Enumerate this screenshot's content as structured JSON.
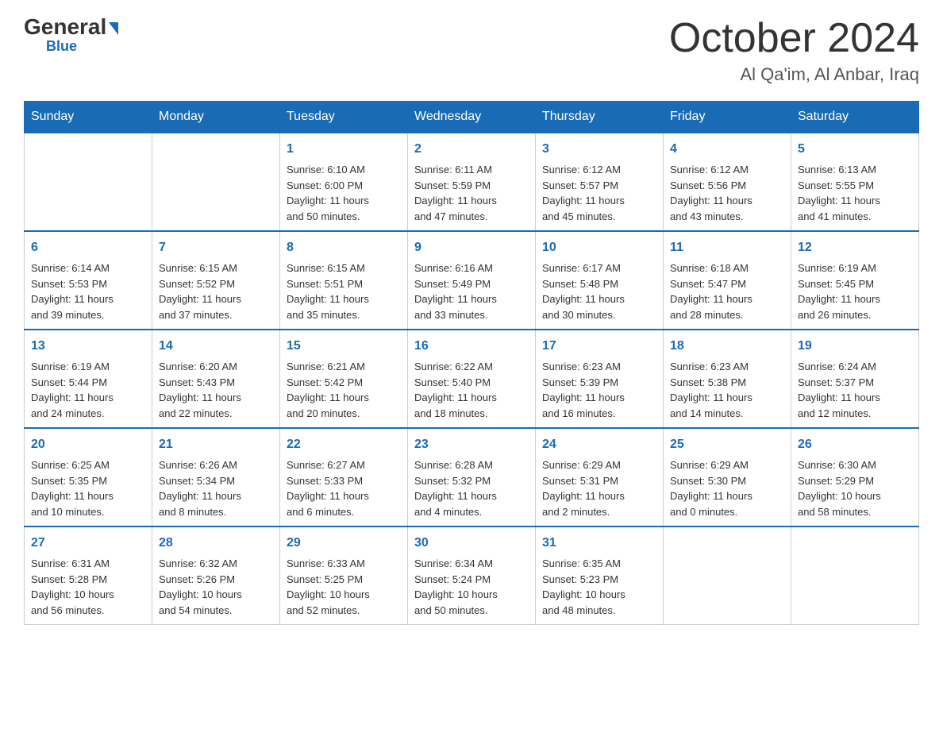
{
  "header": {
    "logo_general": "General",
    "logo_blue": "Blue",
    "month_title": "October 2024",
    "location": "Al Qa'im, Al Anbar, Iraq"
  },
  "days_of_week": [
    "Sunday",
    "Monday",
    "Tuesday",
    "Wednesday",
    "Thursday",
    "Friday",
    "Saturday"
  ],
  "weeks": [
    [
      {
        "day": "",
        "info": ""
      },
      {
        "day": "",
        "info": ""
      },
      {
        "day": "1",
        "info": "Sunrise: 6:10 AM\nSunset: 6:00 PM\nDaylight: 11 hours\nand 50 minutes."
      },
      {
        "day": "2",
        "info": "Sunrise: 6:11 AM\nSunset: 5:59 PM\nDaylight: 11 hours\nand 47 minutes."
      },
      {
        "day": "3",
        "info": "Sunrise: 6:12 AM\nSunset: 5:57 PM\nDaylight: 11 hours\nand 45 minutes."
      },
      {
        "day": "4",
        "info": "Sunrise: 6:12 AM\nSunset: 5:56 PM\nDaylight: 11 hours\nand 43 minutes."
      },
      {
        "day": "5",
        "info": "Sunrise: 6:13 AM\nSunset: 5:55 PM\nDaylight: 11 hours\nand 41 minutes."
      }
    ],
    [
      {
        "day": "6",
        "info": "Sunrise: 6:14 AM\nSunset: 5:53 PM\nDaylight: 11 hours\nand 39 minutes."
      },
      {
        "day": "7",
        "info": "Sunrise: 6:15 AM\nSunset: 5:52 PM\nDaylight: 11 hours\nand 37 minutes."
      },
      {
        "day": "8",
        "info": "Sunrise: 6:15 AM\nSunset: 5:51 PM\nDaylight: 11 hours\nand 35 minutes."
      },
      {
        "day": "9",
        "info": "Sunrise: 6:16 AM\nSunset: 5:49 PM\nDaylight: 11 hours\nand 33 minutes."
      },
      {
        "day": "10",
        "info": "Sunrise: 6:17 AM\nSunset: 5:48 PM\nDaylight: 11 hours\nand 30 minutes."
      },
      {
        "day": "11",
        "info": "Sunrise: 6:18 AM\nSunset: 5:47 PM\nDaylight: 11 hours\nand 28 minutes."
      },
      {
        "day": "12",
        "info": "Sunrise: 6:19 AM\nSunset: 5:45 PM\nDaylight: 11 hours\nand 26 minutes."
      }
    ],
    [
      {
        "day": "13",
        "info": "Sunrise: 6:19 AM\nSunset: 5:44 PM\nDaylight: 11 hours\nand 24 minutes."
      },
      {
        "day": "14",
        "info": "Sunrise: 6:20 AM\nSunset: 5:43 PM\nDaylight: 11 hours\nand 22 minutes."
      },
      {
        "day": "15",
        "info": "Sunrise: 6:21 AM\nSunset: 5:42 PM\nDaylight: 11 hours\nand 20 minutes."
      },
      {
        "day": "16",
        "info": "Sunrise: 6:22 AM\nSunset: 5:40 PM\nDaylight: 11 hours\nand 18 minutes."
      },
      {
        "day": "17",
        "info": "Sunrise: 6:23 AM\nSunset: 5:39 PM\nDaylight: 11 hours\nand 16 minutes."
      },
      {
        "day": "18",
        "info": "Sunrise: 6:23 AM\nSunset: 5:38 PM\nDaylight: 11 hours\nand 14 minutes."
      },
      {
        "day": "19",
        "info": "Sunrise: 6:24 AM\nSunset: 5:37 PM\nDaylight: 11 hours\nand 12 minutes."
      }
    ],
    [
      {
        "day": "20",
        "info": "Sunrise: 6:25 AM\nSunset: 5:35 PM\nDaylight: 11 hours\nand 10 minutes."
      },
      {
        "day": "21",
        "info": "Sunrise: 6:26 AM\nSunset: 5:34 PM\nDaylight: 11 hours\nand 8 minutes."
      },
      {
        "day": "22",
        "info": "Sunrise: 6:27 AM\nSunset: 5:33 PM\nDaylight: 11 hours\nand 6 minutes."
      },
      {
        "day": "23",
        "info": "Sunrise: 6:28 AM\nSunset: 5:32 PM\nDaylight: 11 hours\nand 4 minutes."
      },
      {
        "day": "24",
        "info": "Sunrise: 6:29 AM\nSunset: 5:31 PM\nDaylight: 11 hours\nand 2 minutes."
      },
      {
        "day": "25",
        "info": "Sunrise: 6:29 AM\nSunset: 5:30 PM\nDaylight: 11 hours\nand 0 minutes."
      },
      {
        "day": "26",
        "info": "Sunrise: 6:30 AM\nSunset: 5:29 PM\nDaylight: 10 hours\nand 58 minutes."
      }
    ],
    [
      {
        "day": "27",
        "info": "Sunrise: 6:31 AM\nSunset: 5:28 PM\nDaylight: 10 hours\nand 56 minutes."
      },
      {
        "day": "28",
        "info": "Sunrise: 6:32 AM\nSunset: 5:26 PM\nDaylight: 10 hours\nand 54 minutes."
      },
      {
        "day": "29",
        "info": "Sunrise: 6:33 AM\nSunset: 5:25 PM\nDaylight: 10 hours\nand 52 minutes."
      },
      {
        "day": "30",
        "info": "Sunrise: 6:34 AM\nSunset: 5:24 PM\nDaylight: 10 hours\nand 50 minutes."
      },
      {
        "day": "31",
        "info": "Sunrise: 6:35 AM\nSunset: 5:23 PM\nDaylight: 10 hours\nand 48 minutes."
      },
      {
        "day": "",
        "info": ""
      },
      {
        "day": "",
        "info": ""
      }
    ]
  ]
}
